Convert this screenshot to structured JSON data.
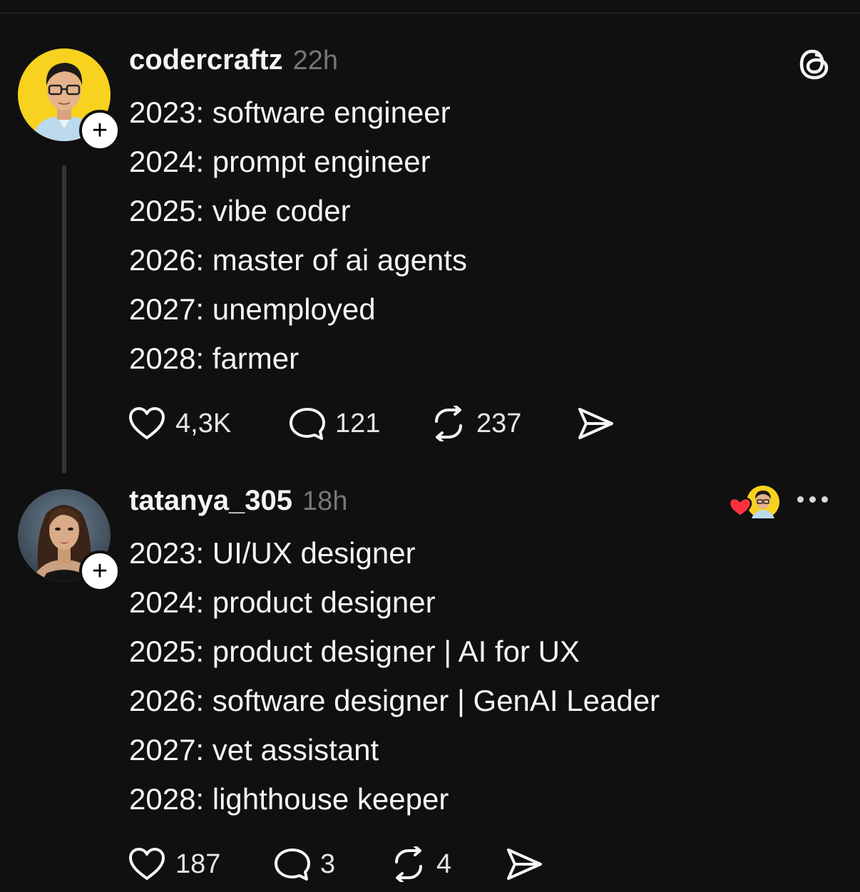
{
  "posts": [
    {
      "username": "codercraftz",
      "time": "22h",
      "avatar_icon": "user-avatar-man-yellow-bg",
      "follow_label": "+",
      "lines": [
        "2023: software engineer",
        "2024: prompt engineer",
        "2025: vibe coder",
        "2026: master of ai agents",
        "2027: unemployed",
        "2028: farmer"
      ],
      "actions": {
        "likes": "4,3K",
        "replies": "121",
        "reposts": "237"
      }
    },
    {
      "username": "tatanya_305",
      "time": "18h",
      "avatar_icon": "user-avatar-woman",
      "follow_label": "+",
      "lines": [
        "2023: UI/UX designer",
        "2024: product designer",
        "2025: product designer | AI for UX",
        "2026: software designer | GenAI Leader",
        "2027: vet assistant",
        "2028: lighthouse keeper"
      ],
      "actions": {
        "likes": "187",
        "replies": "3",
        "reposts": "4"
      }
    }
  ],
  "colors": {
    "background": "#101010",
    "text": "#f3f5f7",
    "muted": "#777777",
    "accent_heart": "#ff3040",
    "avatar_yellow": "#f7d21e"
  }
}
